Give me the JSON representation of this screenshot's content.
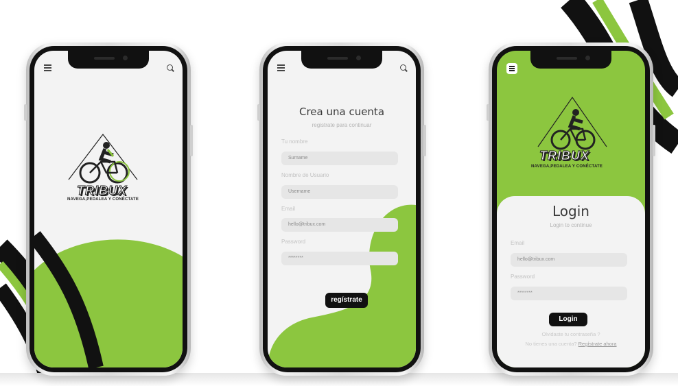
{
  "colors": {
    "accent": "#8cc63f",
    "dark": "#111111",
    "field": "#e6e6e6"
  },
  "icons": {
    "menu": "hamburger-menu-icon",
    "search": "search-icon",
    "logo": "cyclist-logo"
  },
  "brand": {
    "name": "TRIBUX",
    "tagline": "NAVEGA,PEDALEA Y CONÉCTATE"
  },
  "register": {
    "title": "Crea una cuenta",
    "subtitle": "registrate para continuar",
    "fields": [
      {
        "label": "Tu nombre",
        "value": "Surname"
      },
      {
        "label": "Nombre de Usuario",
        "value": "Username"
      },
      {
        "label": "Email",
        "value": "hello@tribux.com"
      },
      {
        "label": "Password",
        "value": "********"
      }
    ],
    "button": "regístrate"
  },
  "login": {
    "title": "Login",
    "subtitle": "Login to continue",
    "fields": [
      {
        "label": "Email",
        "value": "hello@tribux.com"
      },
      {
        "label": "Password",
        "value": "********"
      }
    ],
    "button": "Login",
    "forgot": "Olvidaste tu contraseña ?",
    "no_account": "No tienes una cuenta?",
    "register_link": "Regístrate ahora"
  }
}
